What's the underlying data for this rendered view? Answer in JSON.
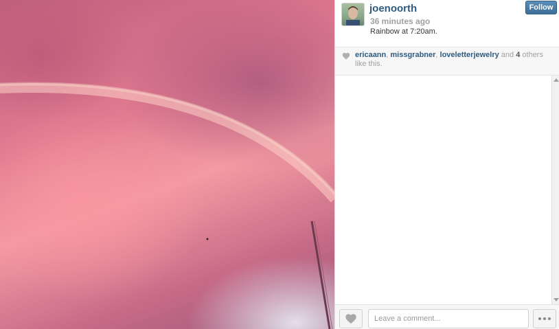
{
  "post": {
    "username": "joenoorth",
    "timestamp": "36 minutes ago",
    "caption": "Rainbow at 7:20am.",
    "follow_label": "Follow"
  },
  "likes": {
    "users": [
      "ericaann",
      "missgrabner",
      "loveletterjewelry"
    ],
    "separator": ", ",
    "and_text": " and ",
    "others_count": "4",
    "others_text": " others like this."
  },
  "comment_box": {
    "placeholder": "Leave a comment..."
  },
  "icons": {
    "like": "heart-icon",
    "more": "ellipsis-icon"
  },
  "colors": {
    "link": "#2f5a80",
    "follow_button": "#4a7ba5"
  }
}
